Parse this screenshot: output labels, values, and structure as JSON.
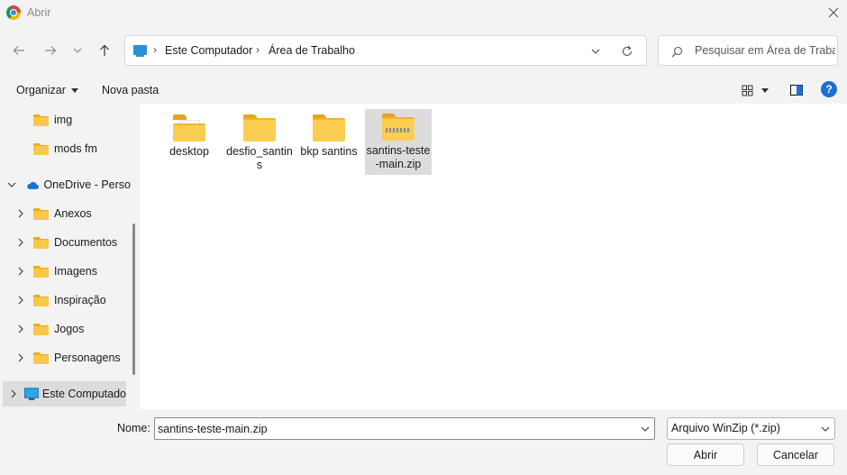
{
  "window": {
    "title": "Abrir",
    "app_icon": "chrome-icon"
  },
  "navigation": {
    "back_icon": "arrow-left-icon",
    "forward_icon": "arrow-right-icon",
    "recent_icon": "chevron-down-icon",
    "up_icon": "arrow-up-icon",
    "address": {
      "location_icon": "computer-icon",
      "crumbs": [
        "Este Computador",
        "Área de Trabalho"
      ],
      "separator": "›"
    },
    "search": {
      "placeholder": "Pesquisar em Área de Trabal..."
    }
  },
  "commandbar": {
    "organize_label": "Organizar",
    "new_folder_label": "Nova pasta",
    "help_label": "?"
  },
  "sidebar": {
    "items": [
      {
        "label": "img",
        "icon": "folder-icon",
        "expander": false,
        "indent": 1
      },
      {
        "label": "mods fm",
        "icon": "folder-icon",
        "expander": false,
        "indent": 1
      },
      {
        "label": "OneDrive - Perso",
        "icon": "onedrive-cloud-icon",
        "expander": "expanded",
        "indent": 0
      },
      {
        "label": "Anexos",
        "icon": "folder-icon",
        "expander": "collapsed",
        "indent": 1
      },
      {
        "label": "Documentos",
        "icon": "folder-icon",
        "expander": "collapsed",
        "indent": 1
      },
      {
        "label": "Imagens",
        "icon": "folder-icon",
        "expander": "collapsed",
        "indent": 1
      },
      {
        "label": "Inspiração",
        "icon": "folder-icon",
        "expander": "collapsed",
        "indent": 1
      },
      {
        "label": "Jogos",
        "icon": "folder-icon",
        "expander": "collapsed",
        "indent": 1
      },
      {
        "label": "Personagens",
        "icon": "folder-icon",
        "expander": "collapsed",
        "indent": 1
      },
      {
        "label": "Este Computado",
        "icon": "computer-icon",
        "expander": "collapsed",
        "indent": 0,
        "selected": true
      }
    ]
  },
  "files": [
    {
      "label": "desktop",
      "icon": "folder-with-document-icon",
      "selected": false
    },
    {
      "label": "desfio_santins",
      "icon": "folder-icon",
      "selected": false
    },
    {
      "label": "bkp santins",
      "icon": "folder-icon",
      "selected": false
    },
    {
      "label": "santins-teste-main.zip",
      "icon": "zip-folder-icon",
      "selected": true
    }
  ],
  "footer": {
    "name_label": "Nome:",
    "name_value": "santins-teste-main.zip",
    "file_type": "Arquivo WinZip (*.zip)",
    "open_label": "Abrir",
    "cancel_label": "Cancelar"
  },
  "colors": {
    "accent": "#1f6fd1",
    "folder": "#f8c84a",
    "selection": "#dcdcdc"
  }
}
